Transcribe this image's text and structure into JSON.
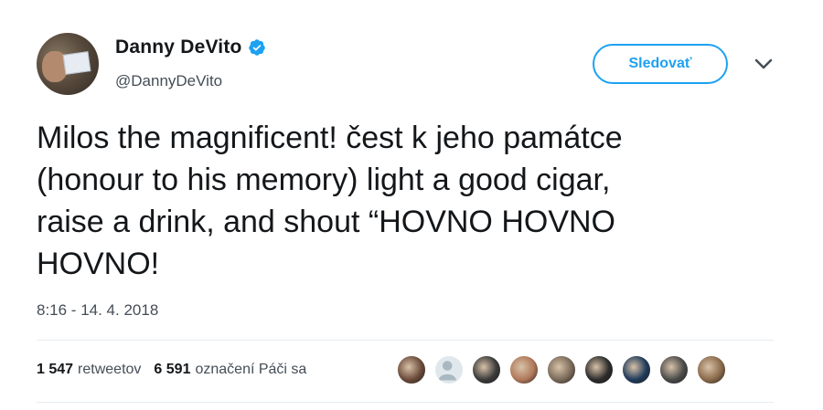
{
  "author": {
    "name": "Danny DeVito",
    "handle": "@DannyDeVito"
  },
  "actions": {
    "follow_label": "Sledovať"
  },
  "tweet": {
    "text": "Milos the magnificent! čest k jeho památce\n(honour to his memory) light a good cigar,\nraise a drink, and shout “HOVNO HOVNO\nHOVNO!",
    "timestamp": "8:16 - 14. 4. 2018"
  },
  "stats": {
    "retweets_count": "1 547",
    "retweets_label": "retweetov",
    "likes_count": "6 591",
    "likes_label": "označení Páči sa"
  },
  "likers": [
    {
      "icon": "liker-avatar",
      "color": "#6b4a3a"
    },
    {
      "icon": "default-avatar",
      "color": "#aab8c2"
    },
    {
      "icon": "liker-avatar",
      "color": "#3a3a3a"
    },
    {
      "icon": "liker-avatar",
      "color": "#b0785a"
    },
    {
      "icon": "liker-avatar",
      "color": "#7a6a5a"
    },
    {
      "icon": "liker-avatar",
      "color": "#2b2b2b"
    },
    {
      "icon": "liker-avatar",
      "color": "#1f3a5a"
    },
    {
      "icon": "liker-avatar",
      "color": "#4a4a4a"
    },
    {
      "icon": "liker-avatar",
      "color": "#8a6a4a"
    }
  ],
  "colors": {
    "accent": "#1da1f2",
    "text": "#14171a",
    "muted": "#444d56",
    "divider": "#e6ecf0"
  }
}
